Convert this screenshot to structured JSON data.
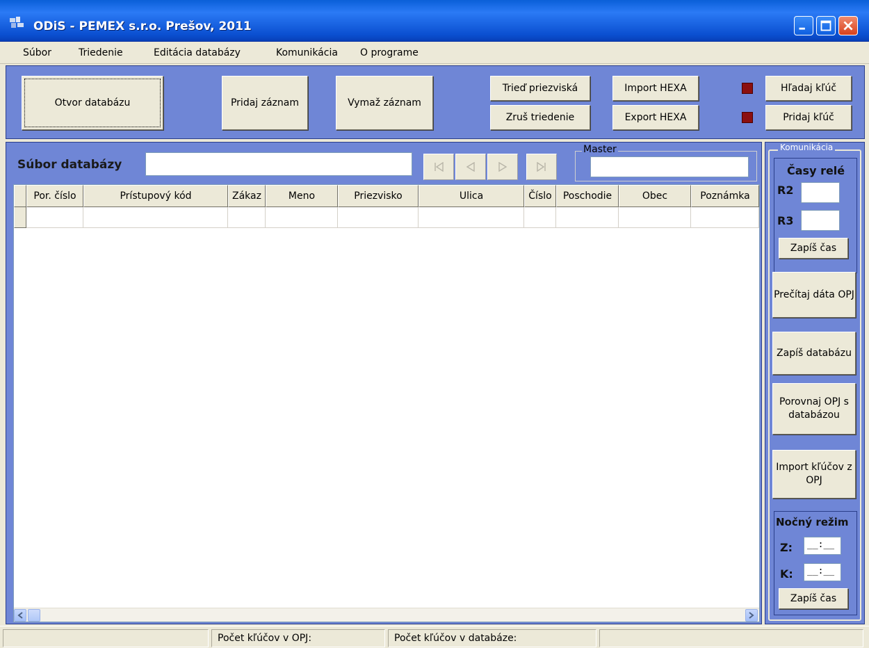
{
  "window": {
    "title": "ODiS  -  PEMEX s.r.o. Prešov, 2011"
  },
  "menu": [
    {
      "label": "Súbor"
    },
    {
      "label": "Triedenie"
    },
    {
      "label": "Editácia databázy"
    },
    {
      "label": "Komunikácia"
    },
    {
      "label": "O programe"
    }
  ],
  "toolbar": {
    "open_db": "Otvor databázu",
    "add_record": "Pridaj záznam",
    "delete_record": "Vymaž záznam",
    "sort_surnames": "Trieď priezviská",
    "cancel_sort": "Zruš triedenie",
    "import_hexa": "Import HEXA",
    "export_hexa": "Export HEXA",
    "find_key": "Hľadaj kľúč",
    "add_key": "Pridaj kľúč",
    "led_color": "#8b0f0f"
  },
  "main": {
    "db_file_label": "Súbor databázy",
    "db_file_value": "",
    "master_label": "Master",
    "master_value": "",
    "nav": [
      "first-icon",
      "prev-icon",
      "next-icon",
      "last-icon"
    ]
  },
  "grid": {
    "columns": [
      "Por. číslo",
      "Prístupový kód",
      "Zákaz",
      "Meno",
      "Priezvisko",
      "Ulica",
      "Číslo",
      "Poschodie",
      "Obec",
      "Poznámka"
    ],
    "rows": [
      [
        "",
        "",
        "",
        "",
        "",
        "",
        "",
        "",
        "",
        ""
      ]
    ]
  },
  "komunikacia": {
    "title": "Komunikácia",
    "casy_rele_label": "Časy relé",
    "r2_label": "R2",
    "r2_value": "",
    "r3_label": "R3",
    "r3_value": "",
    "write_time_1": "Zapíš čas",
    "read_opj": "Prečítaj dáta OPJ",
    "write_db": "Zapíš databázu",
    "compare": "Porovnaj OPJ s databázou",
    "import_keys": "Import kľúčov z OPJ",
    "night_mode_label": "Nočný režim",
    "z_label": "Z:",
    "z_value": "__:__",
    "k_label": "K:",
    "k_value": "__:__",
    "write_time_2": "Zapíš čas"
  },
  "statusbar": {
    "keys_opj": "Počet kľúčov v OPJ:",
    "keys_db": "Počet kľúčov v databáze:"
  }
}
